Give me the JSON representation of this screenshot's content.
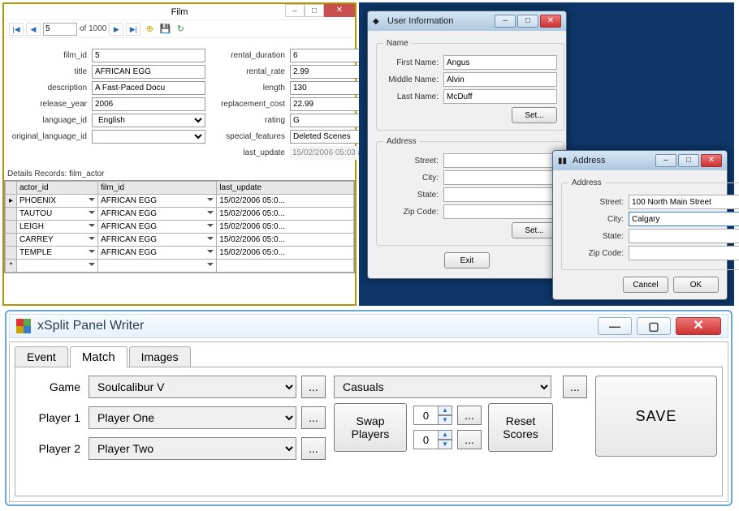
{
  "film": {
    "title": "Film",
    "nav": {
      "page": "5",
      "of_label": "of 1000"
    },
    "fields": {
      "film_id": {
        "label": "film_id",
        "value": "5"
      },
      "title": {
        "label": "title",
        "value": "AFRICAN EGG"
      },
      "description": {
        "label": "description",
        "value": "A Fast-Paced Docu"
      },
      "release_year": {
        "label": "release_year",
        "value": "2006"
      },
      "language_id": {
        "label": "language_id",
        "value": "English"
      },
      "original_language_id": {
        "label": "original_language_id",
        "value": ""
      },
      "rental_duration": {
        "label": "rental_duration",
        "value": "6"
      },
      "rental_rate": {
        "label": "rental_rate",
        "value": "2.99"
      },
      "length": {
        "label": "length",
        "value": "130"
      },
      "replacement_cost": {
        "label": "replacement_cost",
        "value": "22.99"
      },
      "rating": {
        "label": "rating",
        "value": "G"
      },
      "special_features": {
        "label": "special_features",
        "value": "Deleted Scenes"
      },
      "last_update": {
        "label": "last_update",
        "value": "15/02/2006 05:03 a"
      }
    },
    "details_label": "Details Records: film_actor",
    "grid": {
      "headers": [
        "actor_id",
        "film_id",
        "last_update"
      ],
      "rows": [
        {
          "actor_id": "PHOENIX",
          "film_id": "AFRICAN EGG",
          "last_update": "15/02/2006 05:0..."
        },
        {
          "actor_id": "TAUTOU",
          "film_id": "AFRICAN EGG",
          "last_update": "15/02/2006 05:0..."
        },
        {
          "actor_id": "LEIGH",
          "film_id": "AFRICAN EGG",
          "last_update": "15/02/2006 05:0..."
        },
        {
          "actor_id": "CARREY",
          "film_id": "AFRICAN EGG",
          "last_update": "15/02/2006 05:0..."
        },
        {
          "actor_id": "TEMPLE",
          "film_id": "AFRICAN EGG",
          "last_update": "15/02/2006 05:0..."
        }
      ]
    }
  },
  "user_info": {
    "title": "User Information",
    "name_legend": "Name",
    "first_name_label": "First Name:",
    "first_name": "Angus",
    "middle_name_label": "Middle Name:",
    "middle_name": "Alvin",
    "last_name_label": "Last Name:",
    "last_name": "McDuff",
    "set_btn": "Set...",
    "address_legend": "Address",
    "street_label": "Street:",
    "street": "",
    "city_label": "City:",
    "city": "",
    "state_label": "State:",
    "state": "",
    "zip_label": "Zip Code:",
    "zip": "",
    "exit_btn": "Exit"
  },
  "address": {
    "title": "Address",
    "legend": "Address",
    "street_label": "Street:",
    "street": "100 North Main Street",
    "city_label": "City:",
    "city": "Calgary",
    "state_label": "State:",
    "state": "",
    "zip_label": "Zip Code:",
    "zip": "",
    "cancel_btn": "Cancel",
    "ok_btn": "OK"
  },
  "xsplit": {
    "title": "xSplit Panel Writer",
    "tabs": {
      "event": "Event",
      "match": "Match",
      "images": "Images"
    },
    "game_label": "Game",
    "game_value": "Soulcalibur V",
    "player1_label": "Player 1",
    "player1_value": "Player One",
    "player2_label": "Player 2",
    "player2_value": "Player Two",
    "round_value": "Casuals",
    "ellipsis": "...",
    "swap_btn": "Swap\nPlayers",
    "reset_btn": "Reset\nScores",
    "score1": "0",
    "score2": "0",
    "save_btn": "SAVE"
  }
}
